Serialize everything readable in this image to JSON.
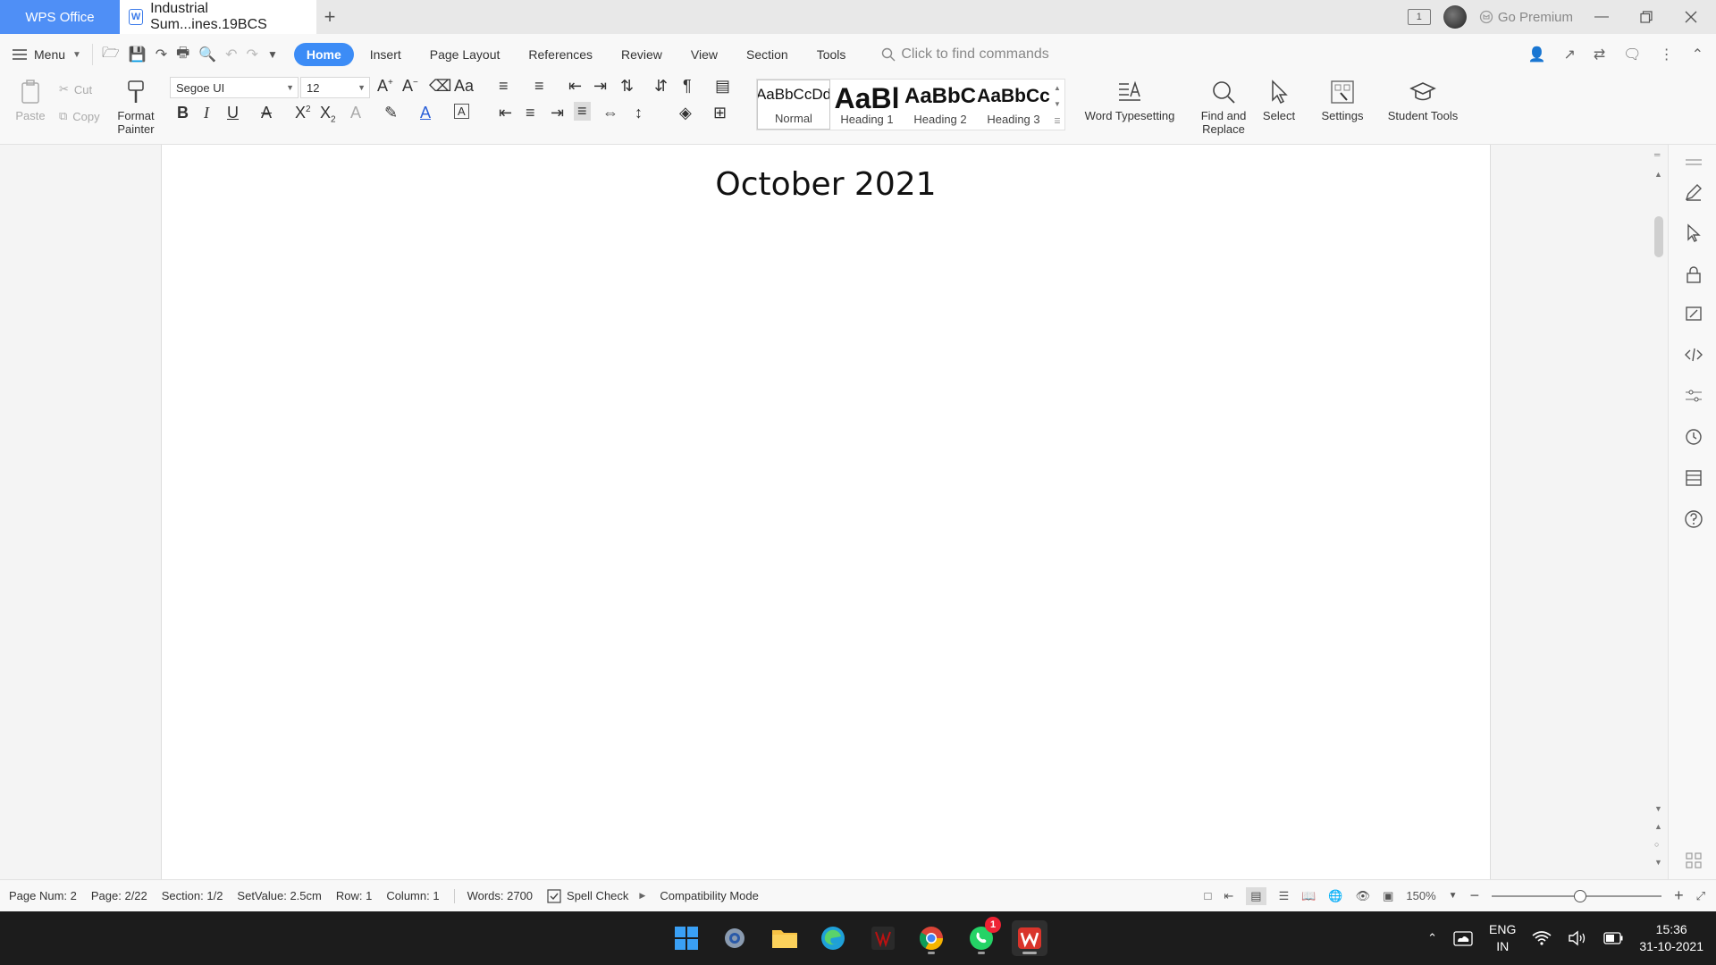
{
  "titlebar": {
    "app_tab": "WPS Office",
    "doc_tab": "Industrial Sum...ines.19BCS",
    "pages_badge": "1",
    "premium": "Go Premium"
  },
  "menubar": {
    "menu_label": "Menu",
    "tabs": [
      "Home",
      "Insert",
      "Page Layout",
      "References",
      "Review",
      "View",
      "Section",
      "Tools"
    ],
    "find_placeholder": "Click to find commands"
  },
  "ribbon": {
    "paste": "Paste",
    "cut": "Cut",
    "copy": "Copy",
    "format_painter_1": "Format",
    "format_painter_2": "Painter",
    "font_name": "Segoe UI",
    "font_size": "12",
    "styles": [
      {
        "sample": "AaBbCcDd",
        "name": "Normal"
      },
      {
        "sample": "AaBl",
        "name": "Heading 1"
      },
      {
        "sample": "AaBbC",
        "name": "Heading 2"
      },
      {
        "sample": "AaBbCc",
        "name": "Heading 3"
      }
    ],
    "word_typesetting": "Word Typesetting",
    "find_replace_1": "Find and",
    "find_replace_2": "Replace",
    "select": "Select",
    "settings": "Settings",
    "student_tools": "Student Tools"
  },
  "document": {
    "heading": "October 2021"
  },
  "statusbar": {
    "page_num": "Page Num: 2",
    "page": "Page: 2/22",
    "section": "Section: 1/2",
    "setvalue": "SetValue: 2.5cm",
    "row": "Row: 1",
    "column": "Column: 1",
    "words": "Words: 2700",
    "spell_check": "Spell Check",
    "compat": "Compatibility Mode",
    "zoom": "150%"
  },
  "taskbar": {
    "whatsapp_badge": "1",
    "lang_1": "ENG",
    "lang_2": "IN",
    "time": "15:36",
    "date": "31-10-2021"
  },
  "colors": {
    "accent": "#3c8cf6",
    "wps_tab": "#4f8ff6",
    "taskbar": "#1c1c1c"
  }
}
